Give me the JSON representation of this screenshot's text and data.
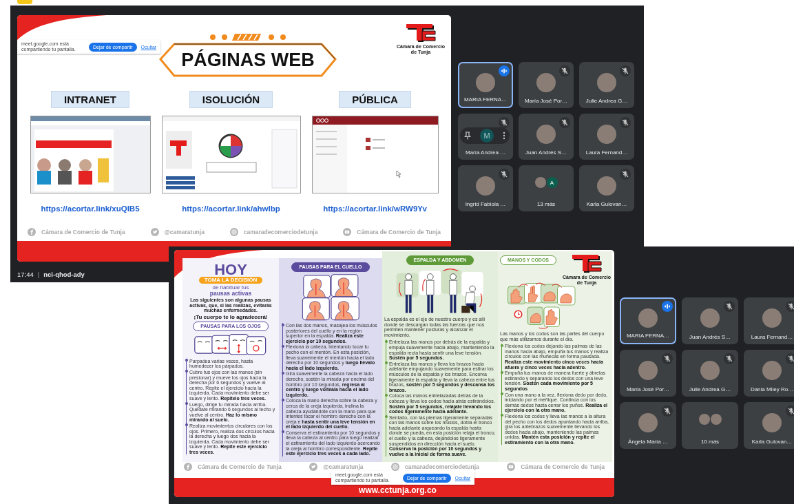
{
  "meeting_1": {
    "slide": {
      "share_bar": {
        "message": "meet.google.com está compartiendo tu pantalla.",
        "stop_button": "Dejar de compartir",
        "hide_link": "Ocultar"
      },
      "title": "PÁGINAS WEB",
      "logo_caption": "Cámara de Comercio de Tunja",
      "sites": [
        {
          "label": "INTRANET",
          "kind": "portal",
          "link": "https://acortar.link/xuQlB5"
        },
        {
          "label": "ISOLUCIÓN",
          "kind": "diagram",
          "link": "https://acortar.link/ahwIbp"
        },
        {
          "label": "PÚBLICA",
          "kind": "files",
          "link": "https://acortar.link/wRW9Yv"
        }
      ],
      "footer": [
        {
          "kind": "facebook",
          "text": "Cámara de Comercio de Tunja"
        },
        {
          "kind": "twitter",
          "text": "@camaratunja"
        },
        {
          "kind": "instagram",
          "text": "camaradecomerciodetunja"
        },
        {
          "kind": "youtube",
          "text": "Cámara de Comercio de Tunja"
        }
      ]
    },
    "participants": [
      {
        "kind": "person",
        "name": "MARIA FERNA…",
        "speaking": true,
        "muted": false
      },
      {
        "kind": "person",
        "name": "María José Por…",
        "speaking": false,
        "muted": true
      },
      {
        "kind": "person",
        "name": "Julie Andrea G…",
        "speaking": false,
        "muted": true
      },
      {
        "kind": "hover",
        "name": "María Andrea …",
        "speaking": false,
        "muted": true,
        "initial": "M"
      },
      {
        "kind": "person",
        "name": "Juan Andrés S…",
        "speaking": false,
        "muted": true
      },
      {
        "kind": "person",
        "name": "Laura Fernand…",
        "speaking": false,
        "muted": true
      },
      {
        "kind": "person",
        "name": "Ingrid Fabiola …",
        "speaking": false,
        "muted": true
      },
      {
        "kind": "more",
        "label": "13 más",
        "avatars": [
          {
            "kind": "photo"
          },
          {
            "kind": "letter",
            "letter": "A"
          }
        ]
      },
      {
        "kind": "person",
        "name": "Karla Gulovan…",
        "speaking": false,
        "muted": true
      }
    ],
    "time": "17:44",
    "separator": "|",
    "meeting_code": "nci-qhod-ady"
  },
  "meeting_2": {
    "slide": {
      "headline": "HOY",
      "banner": "TOMA LA DECISIÓN",
      "subtitle": "de habituar tus",
      "subtitle_bold": "pausas activas",
      "intro": "Las siguientes son algunas pausas activas, que, si las realizas, evitarás muchas enfermedades.",
      "exclamation": "¡Tu cuerpo te lo agradecerá!",
      "sections": [
        {
          "kind": "eyes",
          "title": "PAUSAS PARA LOS OJOS",
          "filled": false,
          "steps": [
            "Parpadea varias veces, hasta humedecer los párpados.",
            "Cubre tus ojos con las manos (sin presionar) y mueve los ojos hacia la derecha por 6 segundos y vuelve al centro. Repite el ejercicio hacia la izquierda. Cada movimiento debe ser suave y lento. **Repítelo tres veces.**",
            "Luego, dirige tu mirada hacia arriba. Quédate mirando 6 segundos al techo y vuelve al centro. **Haz lo mismo mirando al suelo.**",
            "Realiza movimientos circulares con los ojos. Primero, realiza dos círculos hacia la derecha y luego dos hacia la izquierda. Cada movimiento debe ser suave y lento. **Repite este ejercicio tres veces.**"
          ]
        },
        {
          "kind": "neck",
          "title": "PAUSAS PARA EL CUELLO",
          "filled": true,
          "steps": [
            "Con las dos manos, masajea los músculos posteriores del cuello y en la región superior en la espalda. **Realiza este ejercicio por 10 segundos.**",
            "Flexiona la cabeza, intentando tocar tu pecho con el mentón. En esta posición, lleva suavemente el mentón hacia el lado derecho por 10 segundos y **luego llévalo hacia el lado izquierdo.**",
            "Gira suavemente la cabeza hacia el lado derecho, sostén la mirada por encima del hombro por 10 segundos, **regresa al centro y luego voltéala hacia el lado izquierdo.**",
            "Coloca la mano derecha sobre la cabeza y cerca de la oreja izquierda, inclina la cabeza ayudándote con la mano para que intentes tocar el hombro derecho con la oreja e **hasta sentir una leve tensión en el lado izquierdo del cuello.**",
            "Conserva el estiramiento por 10 segundos y lleva la cabeza al centro para luego realizar el estiramiento del lado izquierdo acercando la oreja al hombro correspondiente. **Repite este ejercicio tres veces a cada lado.**"
          ]
        },
        {
          "kind": "back",
          "title": "ESPALDA Y ABDOMEN",
          "filled": true,
          "intro": "La espalda es el eje de nuestro cuerpo y es allí donde se descargan todas las fuerzas que nos permiten mantener posturas y alcanzar el movimiento.",
          "steps": [
            "Entrelaza las manos por detrás de la espalda y empuja suavemente hacia abajo, manteniendo la espalda recta hasta sentir una leve tensión. **Sostén por 5 segundos.**",
            "Entrelaza las manos y lleva los brazos hacia adelante empujando suavemente para estirar los músculos de la espalda y los brazos. Encorva ligeramente la espalda y lleva la cabeza entre tus brazos, **sostén por 5 segundos y descansa los brazos.**",
            "Coloca las manos entrelazadas detrás de la cabeza y lleva los codos hacia atrás estirándolos. **Sostén por 5 segundos, relájate llevando los codos ligeramente hacia adelante.**",
            "Sentado, con las piernas ligeramente separadas con las manos sobre los muslos, dobla el tronco hacia adelante arqueando la espalda hasta donde se pueda, en esta posición relaja el tronco, el cuello y la cabeza, dejándolos ligeramente suspendidos en dirección hacia el suelo. **Conserva la posición por 10 segundos y vuelve a la inicial de forma suave.**"
          ]
        },
        {
          "kind": "hands",
          "title": "MANOS Y CODOS",
          "filled": false,
          "intro": "Las manos y los codos son las partes del cuerpo que más utilizamos durante el día.",
          "steps": [
            "Flexiona los codos dejando las palmas de las manos hacia abajo, empuña tus manos y realiza círculos con las muñecas en forma pausada. **Realiza este movimiento cinco veces hacia afuera y cinco veces hacia adentro.**",
            "Empuña tus manos de manera fuerte y ábrelas estirando y separando los dedos con una leve tensión. **Sostén cada movimiento por 5 segundos**",
            "Con una mano a la vez, flexiona dedo por dedo, iniciando por el meñique. Continúa con los demás dedos hasta cerrar los puños. **Realiza el ejercicio con la otra mano.**",
            "Flexiona los codos y lleva las manos a la altura del pecho con los dedos apuntando hacia arriba, gira los antebrazos suavemente llevando los dedos hacia abajo, manteniendo las palmas unidas. **Mantén esta posición y repite el estiramiento con la otra mano.**"
          ]
        }
      ],
      "logo_caption": "Cámara de Comercio de Tunja",
      "footer": [
        {
          "kind": "facebook",
          "text": "Cámara de Comercio de Tunja"
        },
        {
          "kind": "twitter",
          "text": "@camaratunja"
        },
        {
          "kind": "instagram",
          "text": "camaradecomerciodetunja"
        },
        {
          "kind": "youtube",
          "text": "Cámara de Comercio de Tunja"
        }
      ],
      "website": "www.cctunja.org.co",
      "share_bar": {
        "message": "meet.google.com está compartiendo tu pantalla.",
        "stop_button": "Dejar de compartir",
        "hide_link": "Ocultar"
      }
    },
    "participants": [
      {
        "kind": "person",
        "name": "MARIA FERNA…",
        "speaking": true,
        "muted": false
      },
      {
        "kind": "person",
        "name": "Juan Andrés S…",
        "speaking": false,
        "muted": true
      },
      {
        "kind": "person",
        "name": "Laura Fernand…",
        "speaking": false,
        "muted": true
      },
      {
        "kind": "person",
        "name": "María José Por…",
        "speaking": false,
        "muted": true
      },
      {
        "kind": "person",
        "name": "Julie Andrea G…",
        "speaking": false,
        "muted": true
      },
      {
        "kind": "person",
        "name": "Dania Miley Ro…",
        "speaking": false,
        "muted": true
      },
      {
        "kind": "person",
        "name": "Ángela María …",
        "speaking": false,
        "muted": true
      },
      {
        "kind": "more",
        "label": "10 más",
        "avatars": [
          {
            "kind": "photo"
          },
          {
            "kind": "photo"
          }
        ]
      },
      {
        "kind": "person",
        "name": "Karla Gulovan…",
        "speaking": false,
        "muted": true
      }
    ]
  }
}
